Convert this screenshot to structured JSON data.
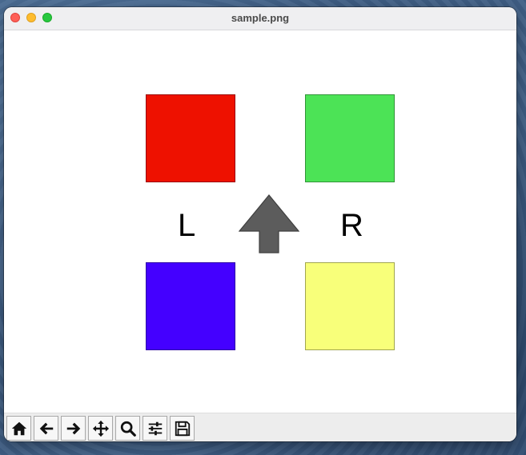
{
  "window": {
    "title": "sample.png"
  },
  "figure": {
    "left_label": "L",
    "right_label": "R",
    "squares": {
      "top_left_color": "#ee1100",
      "top_right_color": "#4ce356",
      "bottom_left_color": "#4400ff",
      "bottom_right_color": "#f8ff7a"
    },
    "arrow_color": "#5c5c5c",
    "arrow_direction": "up"
  },
  "toolbar": {
    "buttons": [
      {
        "name": "home",
        "icon": "home-icon"
      },
      {
        "name": "back",
        "icon": "arrow-left-icon"
      },
      {
        "name": "forward",
        "icon": "arrow-right-icon"
      },
      {
        "name": "pan",
        "icon": "move-icon"
      },
      {
        "name": "zoom",
        "icon": "magnifier-icon"
      },
      {
        "name": "configure-subplots",
        "icon": "sliders-icon"
      },
      {
        "name": "save",
        "icon": "floppy-disk-icon"
      }
    ]
  }
}
